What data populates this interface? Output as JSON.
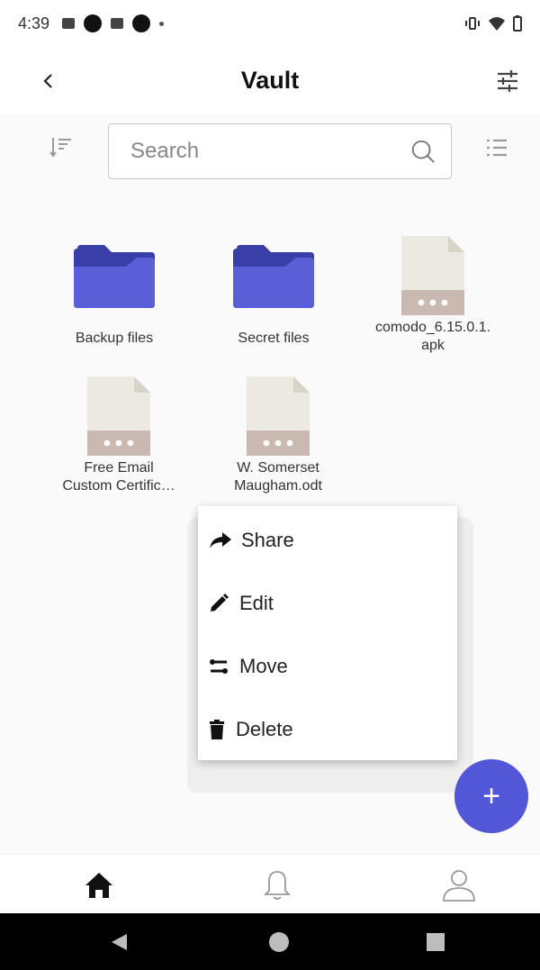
{
  "status_bar": {
    "time": "4:39"
  },
  "header": {
    "title": "Vault",
    "back_icon": "chevron-left-icon",
    "filter_icon": "tune-icon"
  },
  "search": {
    "placeholder": "Search",
    "sort_icon": "sort-icon",
    "view_icon": "list-view-icon"
  },
  "items": [
    {
      "type": "folder",
      "name": "Backup files"
    },
    {
      "type": "folder",
      "name": "Secret files"
    },
    {
      "type": "file",
      "name_line1": "comodo_6.15.0.1.",
      "name_line2": "apk"
    },
    {
      "type": "file",
      "name_line1": "Free Email",
      "name_line2": "Custom Certific…"
    },
    {
      "type": "file",
      "name_line1": "W. Somerset",
      "name_line2": "Maugham.odt"
    }
  ],
  "context_menu": {
    "items": [
      {
        "label": "Share",
        "icon": "share-icon"
      },
      {
        "label": "Edit",
        "icon": "pencil-icon"
      },
      {
        "label": "Move",
        "icon": "move-icon"
      },
      {
        "label": "Delete",
        "icon": "trash-icon"
      }
    ]
  },
  "fab": {
    "label": "+"
  },
  "bottom_nav": {
    "items": [
      {
        "icon": "home-icon",
        "active": true
      },
      {
        "icon": "bell-icon",
        "active": false
      },
      {
        "icon": "person-icon",
        "active": false
      }
    ]
  },
  "colors": {
    "accent": "#5157d6",
    "folder_front": "#5a5fd8",
    "folder_back": "#3a3fa8",
    "file_body": "#ebe9e1",
    "file_band": "#c9b9b1"
  }
}
